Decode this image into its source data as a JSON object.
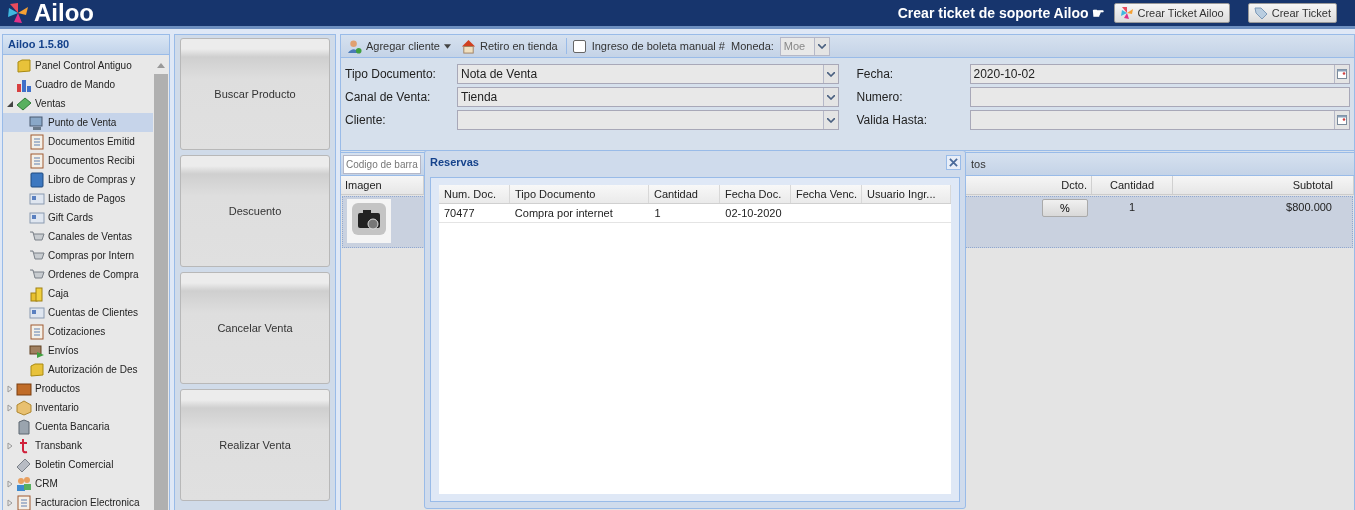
{
  "header": {
    "logo": "Ailoo",
    "support_text": "Crear ticket de soporte Ailoo ☛",
    "buttons": [
      "Crear Ticket Ailoo",
      "Crear Ticket"
    ]
  },
  "sidebar": {
    "title": "Ailoo 1.5.80",
    "items": [
      {
        "label": "Panel Control Antiguo",
        "kind": "link",
        "selected": false
      },
      {
        "label": "Cuadro de Mando",
        "kind": "link",
        "selected": false
      },
      {
        "label": "Ventas",
        "kind": "group",
        "expanded": true,
        "selected": false,
        "children": [
          {
            "label": "Punto de Venta",
            "selected": true
          },
          {
            "label": "Documentos Emitid",
            "selected": false
          },
          {
            "label": "Documentos Recibi",
            "selected": false
          },
          {
            "label": "Libro de Compras y",
            "selected": false
          },
          {
            "label": "Listado de Pagos",
            "selected": false
          },
          {
            "label": "Gift Cards",
            "selected": false
          },
          {
            "label": "Canales de Ventas",
            "selected": false
          },
          {
            "label": "Compras por Intern",
            "selected": false
          },
          {
            "label": "Ordenes de Compra",
            "selected": false
          },
          {
            "label": "Caja",
            "selected": false
          },
          {
            "label": "Cuentas de Clientes",
            "selected": false
          },
          {
            "label": "Cotizaciones",
            "selected": false
          },
          {
            "label": "Envíos",
            "selected": false
          },
          {
            "label": "Autorización de Des",
            "selected": false
          }
        ]
      },
      {
        "label": "Productos",
        "kind": "group",
        "expanded": false,
        "selected": false
      },
      {
        "label": "Inventario",
        "kind": "group",
        "expanded": false,
        "selected": false
      },
      {
        "label": "Cuenta Bancaria",
        "kind": "link",
        "selected": false
      },
      {
        "label": "Transbank",
        "kind": "group",
        "expanded": false,
        "selected": false
      },
      {
        "label": "Boletin Comercial",
        "kind": "link",
        "selected": false
      },
      {
        "label": "CRM",
        "kind": "group",
        "expanded": false,
        "selected": false
      },
      {
        "label": "Facturacion Electronica",
        "kind": "group",
        "expanded": false,
        "selected": false
      }
    ]
  },
  "actions": [
    "Buscar Producto",
    "Descuento",
    "Cancelar Venta",
    "Realizar Venta"
  ],
  "toolbar": {
    "add_client": "Agregar cliente",
    "pickup": "Retiro en tienda",
    "manual_receipt": {
      "label": "Ingreso de boleta manual #",
      "checked": false
    },
    "currency": {
      "label": "Moneda:",
      "placeholder": "Moe"
    }
  },
  "form": {
    "left": [
      {
        "label": "Tipo Documento:",
        "value": "Nota de Venta",
        "kind": "combo"
      },
      {
        "label": "Canal de Venta:",
        "value": "Tienda",
        "kind": "combo"
      },
      {
        "label": "Cliente:",
        "kind": "combo"
      }
    ],
    "right": [
      {
        "label": "Fecha:",
        "value": "2020-10-02",
        "kind": "date"
      },
      {
        "label": "Numero:",
        "kind": "text"
      },
      {
        "label": "Valida Hasta:",
        "kind": "date"
      }
    ]
  },
  "products": {
    "barcode": {
      "placeholder": "Codigo de barra"
    },
    "toolbar_text": "tos",
    "columns": [
      "Imagen",
      "Dcto.",
      "Cantidad",
      "Subtotal"
    ],
    "rows": [
      {
        "discount": "%",
        "quantity": "1",
        "subtotal": "$800.000"
      }
    ]
  },
  "dialog": {
    "title": "Reservas",
    "columns": [
      "Num. Doc.",
      "Tipo Documento",
      "Cantidad",
      "Fecha Doc.",
      "Fecha Venc.",
      "Usuario Ingr..."
    ],
    "rows": [
      {
        "cells": [
          "70477",
          "Compra por internet",
          "1",
          "02-10-2020"
        ]
      }
    ]
  }
}
